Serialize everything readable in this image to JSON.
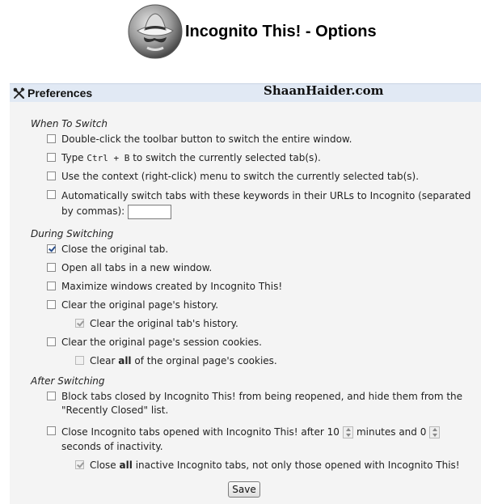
{
  "header": {
    "title": "Incognito This! - Options",
    "logo_icon": "spy-hat-icon"
  },
  "prefbar": {
    "title": "Preferences",
    "icon": "tools-icon"
  },
  "watermark": "ShaanHaider.com",
  "sections": {
    "when": {
      "heading": "When To Switch"
    },
    "during": {
      "heading": "During Switching"
    },
    "after": {
      "heading": "After Switching"
    }
  },
  "options": {
    "dblclick": {
      "label": "Double-click the toolbar button to switch the entire window.",
      "checked": false
    },
    "shortcut": {
      "pre": "Type",
      "key": "Ctrl + B",
      "post": "to switch the currently selected tab(s).",
      "checked": false
    },
    "context": {
      "label": "Use the context (right-click) menu to switch the currently selected tab(s).",
      "checked": false
    },
    "keywords": {
      "label": "Automatically switch tabs with these keywords in their URLs to Incognito (separated by commas):",
      "value": "",
      "checked": false
    },
    "close_original": {
      "label": "Close the original tab.",
      "checked": true
    },
    "new_window": {
      "label": "Open all tabs in a new window.",
      "checked": false
    },
    "maximize": {
      "label": "Maximize windows created by Incognito This!",
      "checked": false
    },
    "clear_history": {
      "label": "Clear the original page's history.",
      "checked": false
    },
    "clear_tab_history": {
      "label": "Clear the original tab's history.",
      "checked": true,
      "disabled": true
    },
    "clear_session": {
      "label": "Clear the original page's session cookies.",
      "checked": false
    },
    "clear_all_cookies": {
      "pre": "Clear",
      "strong": "all",
      "post": "of the orginal page's cookies.",
      "checked": false,
      "disabled": true
    },
    "block_tabs": {
      "label": "Block tabs closed by Incognito This! from being reopened, and hide them from the \"Recently Closed\" list.",
      "checked": false
    },
    "close_inactive": {
      "pre": "Close Incognito tabs opened with Incognito This! after",
      "minutes": "10",
      "mid": "minutes and",
      "seconds": "0",
      "post": "seconds of inactivity.",
      "checked": false
    },
    "close_all_inactive": {
      "pre": "Close",
      "strong": "all",
      "post": "inactive Incognito tabs, not only those opened with Incognito This!",
      "checked": true,
      "disabled": true
    }
  },
  "save_label": "Save"
}
